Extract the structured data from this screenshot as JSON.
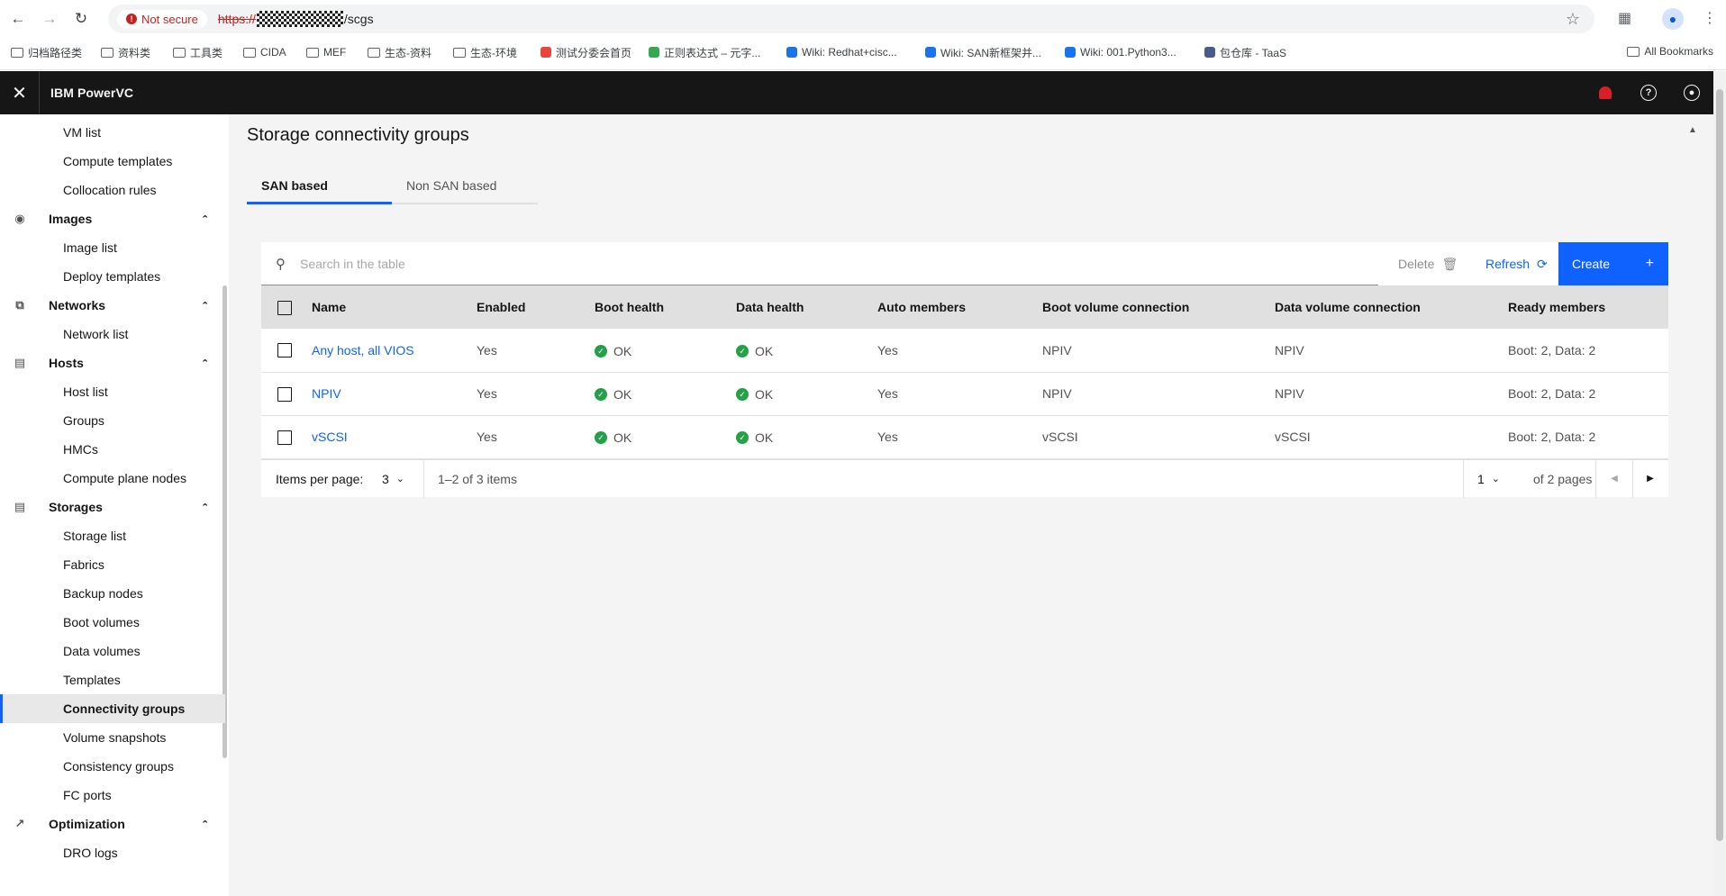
{
  "browser": {
    "security_label": "Not secure",
    "url_scheme": "https://",
    "url_path": "/scgs",
    "bookmarks": [
      {
        "label": "归档路径类",
        "type": "folder"
      },
      {
        "label": "资料类",
        "type": "folder"
      },
      {
        "label": "工具类",
        "type": "folder"
      },
      {
        "label": "CIDA",
        "type": "folder"
      },
      {
        "label": "MEF",
        "type": "folder"
      },
      {
        "label": "生态-资料",
        "type": "folder"
      },
      {
        "label": "生态-环境",
        "type": "folder"
      },
      {
        "label": "测试分委会首页",
        "type": "site",
        "color": "#e8453c"
      },
      {
        "label": "正则表达式 – 元字...",
        "type": "site",
        "color": "#34a853"
      },
      {
        "label": "Wiki: Redhat+cisc...",
        "type": "site",
        "color": "#1a73e8"
      },
      {
        "label": "Wiki: SAN新框架并...",
        "type": "site",
        "color": "#1a73e8"
      },
      {
        "label": "Wiki: 001.Python3...",
        "type": "site",
        "color": "#1a73e8"
      },
      {
        "label": "包仓库 - TaaS",
        "type": "site",
        "color": "#4a5a8a"
      }
    ],
    "all_bookmarks": "All Bookmarks"
  },
  "app": {
    "brand": "IBM PowerVC"
  },
  "sidebar": {
    "items": [
      {
        "label": "VM list",
        "type": "sub"
      },
      {
        "label": "Compute templates",
        "type": "sub"
      },
      {
        "label": "Collocation rules",
        "type": "sub"
      },
      {
        "label": "Images",
        "type": "cat",
        "icon": "camera-icon"
      },
      {
        "label": "Image list",
        "type": "sub"
      },
      {
        "label": "Deploy templates",
        "type": "sub"
      },
      {
        "label": "Networks",
        "type": "cat",
        "icon": "network-icon"
      },
      {
        "label": "Network list",
        "type": "sub"
      },
      {
        "label": "Hosts",
        "type": "cat",
        "icon": "server-icon"
      },
      {
        "label": "Host list",
        "type": "sub"
      },
      {
        "label": "Groups",
        "type": "sub"
      },
      {
        "label": "HMCs",
        "type": "sub"
      },
      {
        "label": "Compute plane nodes",
        "type": "sub"
      },
      {
        "label": "Storages",
        "type": "cat",
        "icon": "storage-icon"
      },
      {
        "label": "Storage list",
        "type": "sub"
      },
      {
        "label": "Fabrics",
        "type": "sub"
      },
      {
        "label": "Backup nodes",
        "type": "sub"
      },
      {
        "label": "Boot volumes",
        "type": "sub"
      },
      {
        "label": "Data volumes",
        "type": "sub"
      },
      {
        "label": "Templates",
        "type": "sub"
      },
      {
        "label": "Connectivity groups",
        "type": "sub",
        "active": true
      },
      {
        "label": "Volume snapshots",
        "type": "sub"
      },
      {
        "label": "Consistency groups",
        "type": "sub"
      },
      {
        "label": "FC ports",
        "type": "sub"
      },
      {
        "label": "Optimization",
        "type": "cat",
        "icon": "chart-icon"
      },
      {
        "label": "DRO logs",
        "type": "sub"
      }
    ]
  },
  "main": {
    "title": "Storage connectivity groups",
    "tabs": [
      "SAN based",
      "Non SAN based"
    ],
    "search_placeholder": "Search in the table",
    "delete_label": "Delete",
    "refresh_label": "Refresh",
    "create_label": "Create",
    "columns": [
      "Name",
      "Enabled",
      "Boot health",
      "Data health",
      "Auto members",
      "Boot volume connection",
      "Data volume connection",
      "Ready members"
    ],
    "rows": [
      {
        "name": "Any host, all VIOS",
        "enabled": "Yes",
        "boot_health": "OK",
        "data_health": "OK",
        "auto_members": "Yes",
        "boot_conn": "NPIV",
        "data_conn": "NPIV",
        "ready": "Boot: 2, Data: 2"
      },
      {
        "name": "NPIV",
        "enabled": "Yes",
        "boot_health": "OK",
        "data_health": "OK",
        "auto_members": "Yes",
        "boot_conn": "NPIV",
        "data_conn": "NPIV",
        "ready": "Boot: 2, Data: 2"
      },
      {
        "name": "vSCSI",
        "enabled": "Yes",
        "boot_health": "OK",
        "data_health": "OK",
        "auto_members": "Yes",
        "boot_conn": "vSCSI",
        "data_conn": "vSCSI",
        "ready": "Boot: 2, Data: 2"
      }
    ],
    "pagination": {
      "items_per_page_label": "Items per page:",
      "items_per_page": "3",
      "range": "1–2 of 3 items",
      "page": "1",
      "of_pages": "of 2 pages"
    }
  }
}
